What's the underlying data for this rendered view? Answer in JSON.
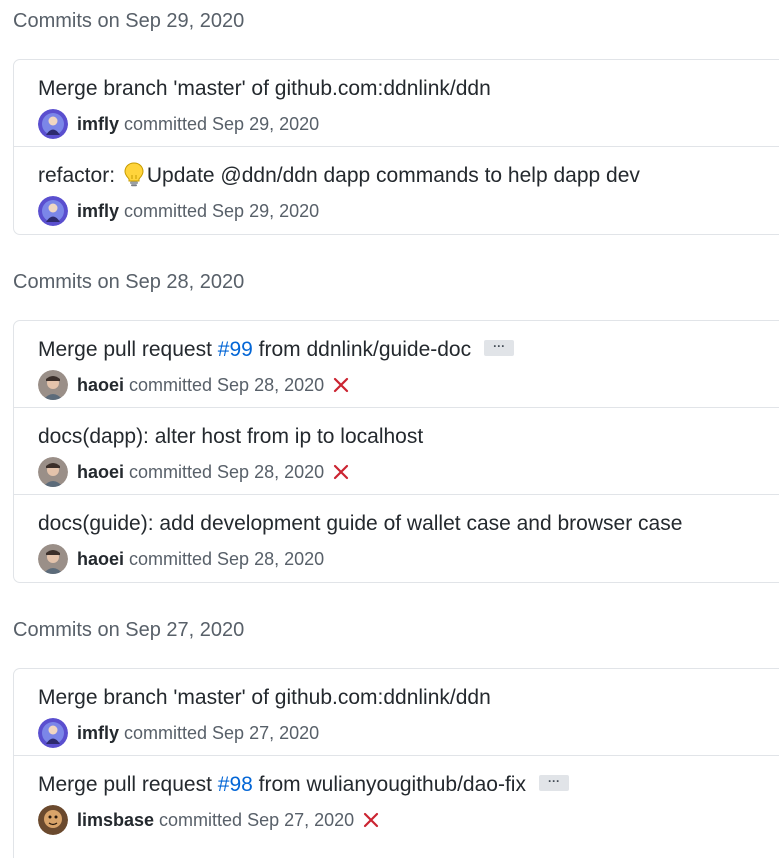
{
  "groups": [
    {
      "title": "Commits on Sep 29, 2020",
      "commits": [
        {
          "pre": "Merge branch 'master' of github.com:ddnlink/ddn",
          "link": "",
          "post": "",
          "author": "imfly",
          "rest": "committed Sep 29, 2020",
          "avatar_icon": "imfly-avatar",
          "status": "",
          "ellipsis": false
        },
        {
          "pre": "refactor: ",
          "emoji": "bulb-emoji",
          "post_emoji": "Update @ddn/ddn dapp commands to help dapp dev",
          "author": "imfly",
          "rest": "committed Sep 29, 2020",
          "avatar_icon": "imfly-avatar",
          "status": "",
          "ellipsis": false
        }
      ]
    },
    {
      "title": "Commits on Sep 28, 2020",
      "commits": [
        {
          "pre": "Merge pull request ",
          "link": "#99",
          "post": " from ddnlink/guide-doc",
          "author": "haoei",
          "rest": "committed Sep 28, 2020",
          "avatar_icon": "haoei-avatar",
          "status": "failure",
          "ellipsis": true
        },
        {
          "pre": "docs(dapp): alter host from ip to localhost",
          "link": "",
          "post": "",
          "author": "haoei",
          "rest": "committed Sep 28, 2020",
          "avatar_icon": "haoei-avatar",
          "status": "failure",
          "ellipsis": false
        },
        {
          "pre": "docs(guide): add development guide of wallet case and browser case",
          "link": "",
          "post": "",
          "author": "haoei",
          "rest": "committed Sep 28, 2020",
          "avatar_icon": "haoei-avatar",
          "status": "",
          "ellipsis": false
        }
      ]
    },
    {
      "title": "Commits on Sep 27, 2020",
      "commits": [
        {
          "pre": "Merge branch 'master' of github.com:ddnlink/ddn",
          "link": "",
          "post": "",
          "author": "imfly",
          "rest": "committed Sep 27, 2020",
          "avatar_icon": "imfly-avatar",
          "status": "",
          "ellipsis": false
        },
        {
          "pre": "Merge pull request ",
          "link": "#98",
          "post": " from wulianyougithub/dao-fix",
          "author": "limsbase",
          "rest": "committed Sep 27, 2020",
          "avatar_icon": "limsbase-avatar",
          "status": "failure",
          "ellipsis": true
        }
      ]
    }
  ],
  "ellipsis_label": "···",
  "colors": {
    "failure": "#cb2431",
    "link": "#0366d6",
    "muted": "#586069",
    "border": "#e1e4e8"
  }
}
